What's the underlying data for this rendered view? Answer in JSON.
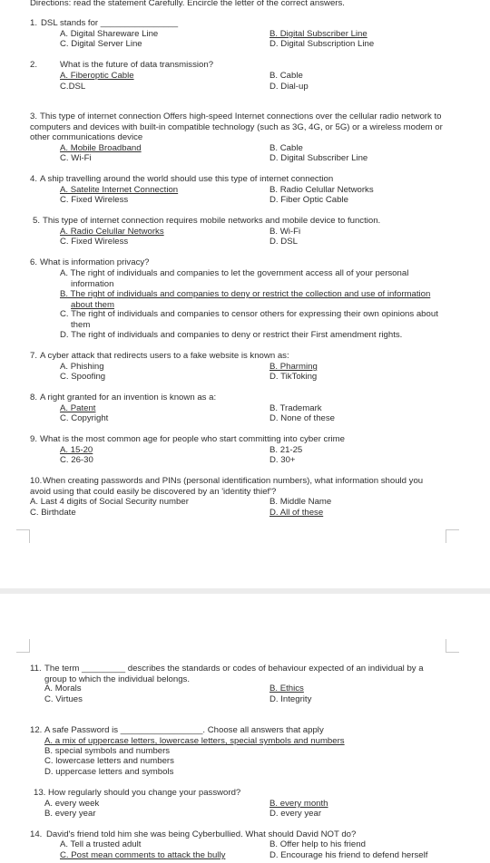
{
  "directions": "Directions: read the statement Carefully. Encircle the letter of the correct answers.",
  "questions": [
    {
      "number": "1.",
      "stem": [
        "DSL stands for ________________"
      ],
      "marked": "B",
      "options": [
        {
          "lines": [
            "A. Digital Shareware Line"
          ]
        },
        {
          "lines": [
            "B. Digital Subscriber Line"
          ]
        },
        {
          "lines": [
            "C. Digital Server Line"
          ]
        },
        {
          "lines": [
            "D. Digital Subscription Line"
          ]
        }
      ]
    },
    {
      "number": "2.",
      "stem": [
        "What is the future of data transmission?"
      ],
      "marked": "A",
      "options": [
        {
          "lines": [
            "A. Fiberoptic Cable"
          ]
        },
        {
          "lines": [
            "B. Cable"
          ]
        },
        {
          "lines": [
            "C.DSL"
          ]
        },
        {
          "lines": [
            "D. Dial-up"
          ]
        }
      ]
    },
    {
      "number": "3.",
      "stem": [
        "This type of internet connection Offers high-speed Internet connections over the cellular radio network to",
        "computers and devices with built-in compatible technology (such as 3G, 4G, or 5G) or a wireless modem or",
        "other communications device"
      ],
      "marked": "A",
      "options": [
        {
          "lines": [
            "A. Mobile Broadband"
          ]
        },
        {
          "lines": [
            "B. Cable"
          ]
        },
        {
          "lines": [
            "C. Wi-Fi"
          ]
        },
        {
          "lines": [
            "D. Digital Subscriber Line"
          ]
        }
      ]
    },
    {
      "number": "4.",
      "stem": [
        "A ship travelling around the world should use this type of internet connection"
      ],
      "marked": "A",
      "options": [
        {
          "lines": [
            "A. Satelite Internet Connection"
          ]
        },
        {
          "lines": [
            "B. Radio Celullar Networks"
          ]
        },
        {
          "lines": [
            "C. Fixed Wireless"
          ]
        },
        {
          "lines": [
            "D. Fiber Optic Cable"
          ]
        }
      ]
    },
    {
      "number": "5.",
      "stem": [
        "This type of internet connection requires mobile networks and mobile device to function."
      ],
      "marked": "A",
      "options": [
        {
          "lines": [
            "A. Radio Celullar Networks"
          ]
        },
        {
          "lines": [
            "B. Wi-Fi"
          ]
        },
        {
          "lines": [
            "C. Fixed Wireless"
          ]
        },
        {
          "lines": [
            "D. DSL"
          ]
        }
      ]
    },
    {
      "number": "6.",
      "stem": [
        "What is information privacy?"
      ],
      "marked": "B",
      "options": [
        {
          "lines": [
            "A. The right of individuals and companies to let the government access all of your personal",
            "information"
          ]
        },
        {
          "lines": [
            "B. The right of individuals and companies to deny or restrict the collection and use of information",
            "about them"
          ]
        },
        {
          "lines": [
            "C. The right of individuals and companies to censor others for expressing their own opinions about",
            "them"
          ]
        },
        {
          "lines": [
            "D. The right of individuals and companies to deny or restrict their First amendment rights."
          ]
        }
      ]
    },
    {
      "number": "7.",
      "stem": [
        "A cyber attack that redirects users to a fake website is known as:"
      ],
      "marked": "B",
      "options": [
        {
          "lines": [
            "A. Phishing"
          ]
        },
        {
          "lines": [
            "B. Pharming"
          ]
        },
        {
          "lines": [
            "C. Spoofing"
          ]
        },
        {
          "lines": [
            "D. TikToking"
          ]
        }
      ]
    },
    {
      "number": "8.",
      "stem": [
        "A right granted for an invention is known as a:"
      ],
      "marked": "A",
      "options": [
        {
          "lines": [
            "A. Patent"
          ]
        },
        {
          "lines": [
            "B. Trademark"
          ]
        },
        {
          "lines": [
            "C. Copyright"
          ]
        },
        {
          "lines": [
            "D. None of these"
          ]
        }
      ]
    },
    {
      "number": "9.",
      "stem": [
        "What is the most common age for people who start committing into cyber crime"
      ],
      "marked": "A",
      "options": [
        {
          "lines": [
            "A. 15-20"
          ]
        },
        {
          "lines": [
            "B. 21-25"
          ]
        },
        {
          "lines": [
            "C. 26-30"
          ]
        },
        {
          "lines": [
            "D. 30+"
          ]
        }
      ]
    },
    {
      "number": "10.",
      "stem": [
        "When creating passwords and PINs (personal identification numbers), what information should you",
        "avoid using that could easily be discovered by an 'identity thief'?"
      ],
      "marked": "D",
      "options": [
        {
          "lines": [
            "A. Last 4 digits of Social Security number"
          ]
        },
        {
          "lines": [
            "B. Middle Name"
          ]
        },
        {
          "lines": [
            "C. Birthdate"
          ]
        },
        {
          "lines": [
            "D. All of these"
          ]
        }
      ]
    },
    {
      "number": "11.",
      "stem": [
        "The term _________ describes the standards or codes of behaviour expected of an individual by a",
        "group to which the individual belongs."
      ],
      "marked": "B",
      "options": [
        {
          "lines": [
            "A.   Morals"
          ]
        },
        {
          "lines": [
            "B. Ethics"
          ]
        },
        {
          "lines": [
            "C.   Virtues"
          ]
        },
        {
          "lines": [
            "D. Integrity"
          ]
        }
      ]
    },
    {
      "number": "12.",
      "stem": [
        "A safe Password is _________________. Choose all answers that apply"
      ],
      "marked": "A",
      "options": [
        {
          "lines": [
            "A.   a mix of uppercase letters, lowercase letters, special symbols and numbers"
          ]
        },
        {
          "lines": [
            "B.   special symbols and numbers"
          ]
        },
        {
          "lines": [
            "C.   lowercase letters and numbers"
          ]
        },
        {
          "lines": [
            "D.   uppercase letters and symbols"
          ]
        }
      ]
    },
    {
      "number": "13.",
      "stem": [
        "How regularly should you change your password?"
      ],
      "marked": "B",
      "options": [
        {
          "lines": [
            "A.   every week"
          ]
        },
        {
          "lines": [
            "B. every month"
          ]
        },
        {
          "lines": [
            "B.   every year"
          ]
        },
        {
          "lines": [
            "D. every year"
          ]
        }
      ]
    },
    {
      "number": "14.",
      "stem": [
        "David's friend told him she was being Cyberbullied. What should David NOT do?"
      ],
      "marked": "C",
      "options": [
        {
          "lines": [
            "A. Tell a trusted adult"
          ]
        },
        {
          "lines": [
            "B. Offer help to his friend"
          ]
        },
        {
          "lines": [
            "C. Post mean comments to attack the bully"
          ]
        },
        {
          "lines": [
            "D. Encourage his friend to defend herself"
          ]
        }
      ]
    }
  ]
}
